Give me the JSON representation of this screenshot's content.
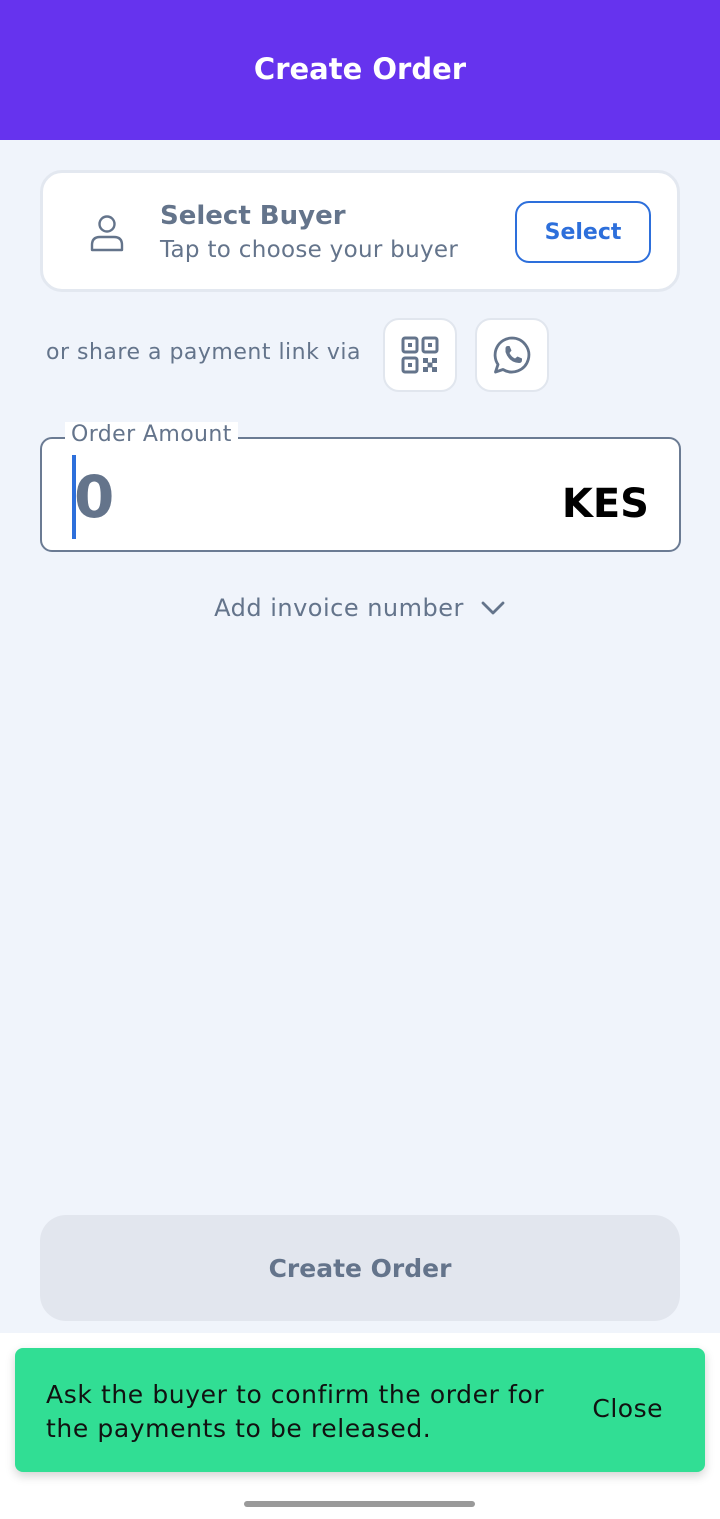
{
  "header": {
    "title": "Create Order"
  },
  "buyer": {
    "icon": "person-icon",
    "title": "Select Buyer",
    "subtitle": "Tap to choose your buyer",
    "select_label": "Select"
  },
  "share": {
    "label": "or share a payment link via",
    "options": [
      {
        "icon": "qr-code-icon"
      },
      {
        "icon": "whatsapp-icon"
      }
    ]
  },
  "amount": {
    "label": "Order Amount",
    "value": "0",
    "currency": "KES"
  },
  "invoice": {
    "label": "Add invoice number",
    "icon": "chevron-down-icon"
  },
  "create_button": {
    "label": "Create Order"
  },
  "snackbar": {
    "message": "Ask the buyer to confirm the order for the payments to be released.",
    "close_label": "Close"
  },
  "colors": {
    "header": "#6633ee",
    "accent": "#2d6fdb",
    "snackbar": "#31de94",
    "background": "#f0f4fb"
  }
}
